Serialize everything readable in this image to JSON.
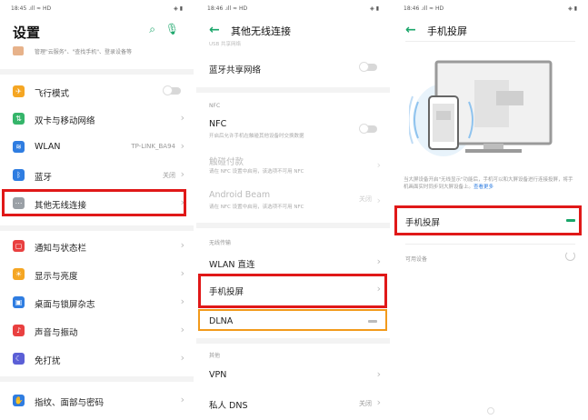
{
  "panel1": {
    "status": {
      "left": "18:45 .ıll ≈ HD",
      "right": "◈ ▮"
    },
    "title": "设置",
    "cloud_text": "管理\"云服务\"、\"查找手机\"、登录设备等",
    "items": [
      {
        "label": "飞行模式",
        "icon_color": "#f5a623",
        "icon_glyph": "✈"
      },
      {
        "label": "双卡与移动网络",
        "icon_color": "#35b56a",
        "icon_glyph": "⇅"
      },
      {
        "label": "WLAN",
        "value": "TP-LINK_BA94",
        "icon_color": "#2f7de1",
        "icon_glyph": "≋"
      },
      {
        "label": "蓝牙",
        "value": "关闭",
        "icon_color": "#2f7de1",
        "icon_glyph": "ᛒ"
      },
      {
        "label": "其他无线连接",
        "icon_color": "#9aa0a6",
        "icon_glyph": "⋯"
      },
      {
        "label": "通知与状态栏",
        "icon_color": "#e94040",
        "icon_glyph": "▢"
      },
      {
        "label": "显示与亮度",
        "icon_color": "#f5a623",
        "icon_glyph": "☀"
      },
      {
        "label": "桌面与锁屏杂志",
        "icon_color": "#2f7de1",
        "icon_glyph": "▣"
      },
      {
        "label": "声音与振动",
        "icon_color": "#e94040",
        "icon_glyph": "♪"
      },
      {
        "label": "免打扰",
        "icon_color": "#5b5fd6",
        "icon_glyph": "☾"
      },
      {
        "label": "指纹、面部与密码",
        "icon_color": "#2f7de1",
        "icon_glyph": "✋"
      }
    ]
  },
  "panel2": {
    "status": {
      "left": "18:46 .ıll ≈ HD",
      "right": "◈ ▮"
    },
    "back": "←",
    "title": "其他无线连接",
    "top_partial": "USB 共享网络",
    "bt_share": "蓝牙共享网络",
    "nfc_section": "NFC",
    "nfc_label": "NFC",
    "nfc_sub": "开启后允许手机在触碰其他设备时交换数据",
    "tap_pay": "触碰付款",
    "tap_pay_sub": "请在 NFC 设置中启用，该选项不可用 NFC",
    "android_beam": "Android Beam",
    "android_beam_value": "关闭",
    "android_beam_sub": "请在 NFC 设置中启用，该选项不可用 NFC",
    "wireless_section": "无线传输",
    "wlan_direct": "WLAN 直连",
    "screencast": "手机投屏",
    "dlna": "DLNA",
    "other_section": "其他",
    "vpn": "VPN",
    "private_dns": "私人 DNS",
    "private_dns_value": "关闭"
  },
  "panel3": {
    "status": {
      "left": "18:46 .ıll ≈ HD",
      "right": "◈ ▮"
    },
    "back": "←",
    "title": "手机投屏",
    "desc_text": "当大屏设备开启\"无线显示\"功能后，手机可以和大屏设备进行连接投屏，将手机画面实时同步到大屏设备上。",
    "desc_link": "查看更多",
    "screencast_label": "手机投屏",
    "available_label": "可用设备"
  },
  "colors": {
    "accent": "#1aa66a",
    "highlight_red": "#e01818",
    "highlight_orange": "#f29a1b"
  }
}
